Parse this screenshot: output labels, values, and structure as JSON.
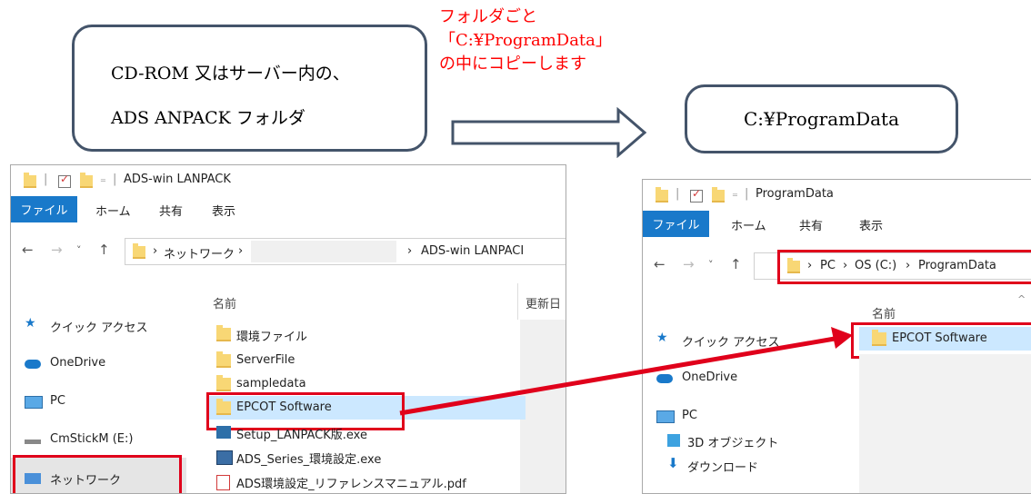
{
  "callouts": {
    "left_line1": "CD-ROM 又はサーバー内の、",
    "left_line2": "ADS ANPACK フォルダ",
    "right": "C:¥ProgramData"
  },
  "note": {
    "line1": "フォルダごと",
    "line2": "「C:¥ProgramData」",
    "line3": "の中にコピーします",
    "color": "#ff0000"
  },
  "left_window": {
    "title": "ADS-win LANPACK",
    "tabs": {
      "file": "ファイル",
      "home": "ホーム",
      "share": "共有",
      "view": "表示"
    },
    "address": {
      "crumb1": "ネットワーク",
      "crumb_last": "ADS-win LANPACI"
    },
    "nav": [
      {
        "label": "クイック アクセス",
        "icon": "star-icon"
      },
      {
        "label": "OneDrive",
        "icon": "cloud-icon"
      },
      {
        "label": "PC",
        "icon": "monitor-icon"
      },
      {
        "label": "CmStickM (E:)",
        "icon": "drive-icon"
      },
      {
        "label": "ネットワーク",
        "icon": "network-icon"
      }
    ],
    "columns": {
      "name": "名前",
      "modified": "更新日"
    },
    "files": [
      {
        "name": "環境ファイル",
        "icon": "folder-icon"
      },
      {
        "name": "ServerFile",
        "icon": "folder-icon"
      },
      {
        "name": "sampledata",
        "icon": "folder-icon"
      },
      {
        "name": "EPCOT Software",
        "icon": "folder-icon"
      },
      {
        "name": "Setup_LANPACK版.exe",
        "icon": "setup-exe-icon"
      },
      {
        "name": "ADS_Series_環境設定.exe",
        "icon": "exe-icon"
      },
      {
        "name": "ADS環境設定_リファレンスマニュアル.pdf",
        "icon": "pdf-icon"
      }
    ]
  },
  "right_window": {
    "title": "ProgramData",
    "tabs": {
      "file": "ファイル",
      "home": "ホーム",
      "share": "共有",
      "view": "表示"
    },
    "address": {
      "crumb1": "PC",
      "crumb2": "OS (C:)",
      "crumb3": "ProgramData"
    },
    "nav": [
      {
        "label": "クイック アクセス",
        "icon": "star-icon"
      },
      {
        "label": "OneDrive",
        "icon": "cloud-icon"
      },
      {
        "label": "PC",
        "icon": "monitor-icon"
      },
      {
        "label": "3D オブジェクト",
        "icon": "cube-icon"
      },
      {
        "label": "ダウンロード",
        "icon": "download-icon"
      }
    ],
    "columns": {
      "name": "名前"
    },
    "files": [
      {
        "name": "EPCOT Software",
        "icon": "folder-icon"
      }
    ]
  },
  "colors": {
    "highlight": "#e0001b",
    "accent": "#1979ca",
    "selection": "#cce8ff",
    "callout_border": "#44546a"
  }
}
